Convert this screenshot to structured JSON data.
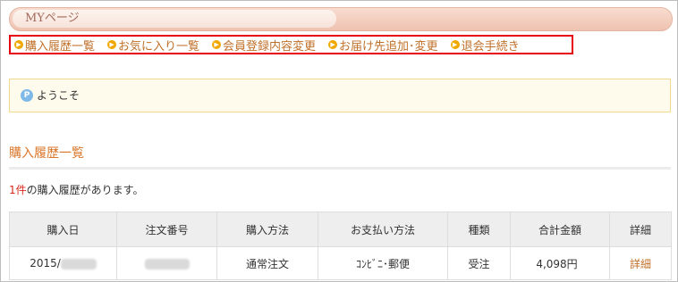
{
  "page": {
    "title": "MYページ"
  },
  "nav": {
    "items": [
      {
        "label": "購入履歴一覧"
      },
      {
        "label": "お気に入り一覧"
      },
      {
        "label": "会員登録内容変更"
      },
      {
        "label": "お届け先追加･変更"
      },
      {
        "label": "退会手続き"
      }
    ]
  },
  "welcome": {
    "icon": "P",
    "text": "ようこそ"
  },
  "history": {
    "title": "購入履歴一覧",
    "count": "1件",
    "count_suffix": "の購入履歴があります。",
    "columns": [
      "購入日",
      "注文番号",
      "購入方法",
      "お支払い方法",
      "種類",
      "合計金額",
      "詳細"
    ],
    "rows": [
      {
        "date": "2015/",
        "order_no": "",
        "method": "通常注文",
        "payment": "ｺﾝﾋﾞﾆ･郵便",
        "type": "受注",
        "total": "4,098円",
        "detail": "詳細"
      }
    ]
  }
}
